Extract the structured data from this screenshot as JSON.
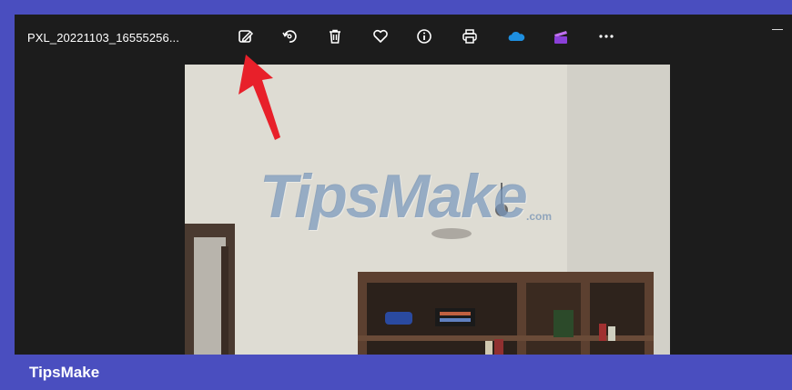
{
  "window": {
    "filename": "PXL_20221103_16555256..."
  },
  "toolbar": {
    "tools": [
      {
        "name": "edit-image-icon",
        "label": "Edit image"
      },
      {
        "name": "rotate-icon",
        "label": "Rotate"
      },
      {
        "name": "delete-icon",
        "label": "Delete"
      },
      {
        "name": "favorite-heart-icon",
        "label": "Favorite"
      },
      {
        "name": "info-icon",
        "label": "File info"
      },
      {
        "name": "print-icon",
        "label": "Print"
      },
      {
        "name": "onedrive-cloud-icon",
        "label": "OneDrive"
      },
      {
        "name": "clipchamp-icon",
        "label": "Clipchamp"
      },
      {
        "name": "more-options-icon",
        "label": "See more"
      }
    ]
  },
  "watermark": {
    "text": "TipsMake",
    "suffix": ".com"
  },
  "footer": {
    "brand": "TipsMake"
  },
  "colors": {
    "frame_bg": "#1c1c1c",
    "border_bar": "#4a4ebf",
    "annotation_arrow": "#e8202a",
    "onedrive": "#1e8fe0",
    "clipchamp": "#a050e0"
  }
}
